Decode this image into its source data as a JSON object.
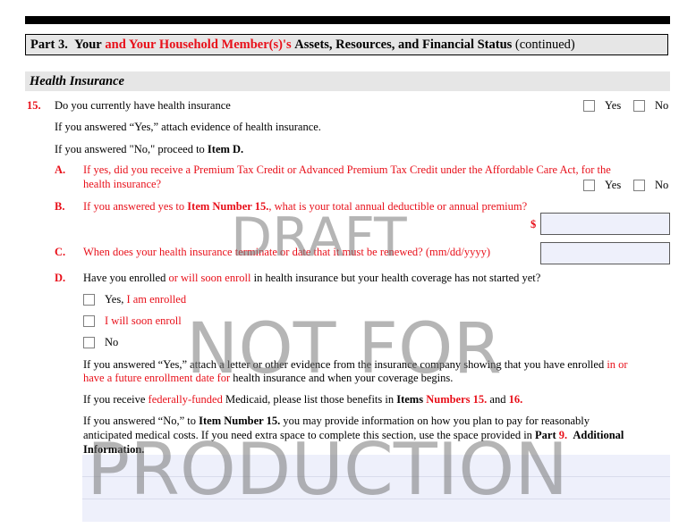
{
  "part_header": {
    "part": "Part 3.",
    "your": "Your",
    "and_household": "and Your Household Member(s)'s",
    "rest": "Assets, Resources, and Financial Status",
    "continued": "(continued)"
  },
  "section_title": "Health Insurance",
  "q15": {
    "number": "15.",
    "question": "Do you currently have health insurance",
    "yes": "Yes",
    "no": "No",
    "note_yes": "If you answered “Yes,” attach evidence of health insurance.",
    "note_no_pre": "If you answered \"No,\" proceed to",
    "note_no_item": "Item D."
  },
  "qA": {
    "letter": "A.",
    "line1": "If yes, did you receive a Premium Tax Credit or Advanced Premium Tax Credit under the Affordable Care Act, for the",
    "line2": "health insurance?",
    "yes": "Yes",
    "no": "No"
  },
  "qB": {
    "letter": "B.",
    "pre": "If you answered yes to",
    "item": "Item Number 15.",
    "post": ", what is your total annual deductible or annual premium?",
    "currency": "$",
    "value": ""
  },
  "qC": {
    "letter": "C.",
    "text": "When does your health insurance terminate or date that it must be renewed? (mm/dd/yyyy)",
    "value": ""
  },
  "qD": {
    "letter": "D.",
    "pre": "Have you enrolled",
    "red1": "or will soon enroll",
    "post": "in health insurance but your health coverage has not started yet?",
    "opt1_a": "Yes,",
    "opt1_b": "I am enrolled",
    "opt2": "I will soon enroll",
    "opt3": "No",
    "p1_a": "If you answered “Yes,” attach a letter or other evidence from the insurance company showing that you have enrolled",
    "p1_b": "in or",
    "p1_c": "have a future enrollment date for",
    "p1_d": "health insurance and when your coverage begins.",
    "p2_a": "If you receive",
    "p2_b": "federally-funded",
    "p2_c": "Medicaid, please list those benefits in",
    "p2_d": "Items",
    "p2_e": "Numbers 15.",
    "p2_f": "and",
    "p2_g": "16.",
    "p3_a": "If you answered “No,” to",
    "p3_b": "Item Number 15.",
    "p3_c": "you may provide information on how you plan to pay for reasonably",
    "p3_d": "anticipated medical costs.  If you need extra space to complete this section, use the space provided in",
    "p3_e": "Part",
    "p3_f": "9.",
    "p3_g": "Additional",
    "p3_h": "Information."
  },
  "watermark": {
    "line1": "DRAFT",
    "line2": "NOT FOR",
    "line3": "PRODUCTION"
  }
}
